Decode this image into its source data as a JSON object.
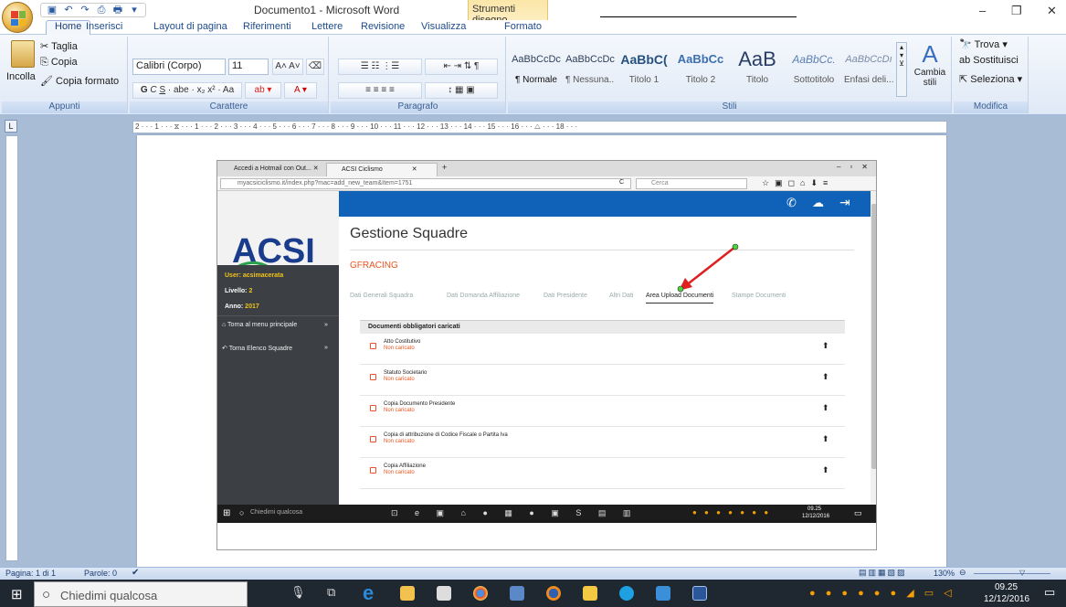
{
  "window": {
    "title": "Documento1 - Microsoft Word",
    "context_tab": "Strumenti disegno",
    "minimize": "–",
    "restore": "❐",
    "close": "✕"
  },
  "tabs": [
    "Home",
    "Inserisci",
    "Layout di pagina",
    "Riferimenti",
    "Lettere",
    "Revisione",
    "Visualizza",
    "Formato"
  ],
  "ribbon": {
    "clipboard": {
      "paste": "Incolla",
      "cut": "Taglia",
      "copy": "Copia",
      "format_painter": "Copia formato",
      "label": "Appunti"
    },
    "font": {
      "name": "Calibri (Corpo)",
      "size": "11",
      "label": "Carattere"
    },
    "paragraph": {
      "label": "Paragrafo"
    },
    "styles": {
      "items": [
        {
          "sample": "AaBbCcDc",
          "name": "¶ Normale"
        },
        {
          "sample": "AaBbCcDc",
          "name": "¶ Nessuna..."
        },
        {
          "sample": "AaBbC(",
          "name": "Titolo 1"
        },
        {
          "sample": "AaBbCc",
          "name": "Titolo 2"
        },
        {
          "sample": "AaB",
          "name": "Titolo"
        },
        {
          "sample": "AaBbCc.",
          "name": "Sottotitolo"
        },
        {
          "sample": "AaBbCcDı",
          "name": "Enfasi deli..."
        }
      ],
      "change": "Cambia stili",
      "label": "Stili"
    },
    "editing": {
      "find": "Trova",
      "replace": "Sostituisci",
      "select": "Seleziona",
      "label": "Modifica"
    }
  },
  "ruler": {
    "marks": "2 · · · 1 · · · ⧖ · · · 1 · · · 2 · · · 3 · · · 4 · · · 5 · · · 6 · · · 7 · · · 8 · · · 9 · · · 10 · · · 11 · · · 12 · · · 13 · · · 14 · · · 15 · · · 16 · · · △ · · · 18 · · ·"
  },
  "browser": {
    "tabs": [
      "Accedi a Hotmail con Out...",
      "ACSI Ciclismo"
    ],
    "url": "myacsiciclismo.it/index.php?mac=add_new_team&Item=1751",
    "search_placeholder": "Cerca"
  },
  "app": {
    "title": "Gestione Squadre",
    "team": "GFRACING",
    "user_label": "User:",
    "user": "acsimacerata",
    "level_label": "Livello:",
    "level": "2",
    "year_label": "Anno:",
    "year": "2017",
    "menu": [
      "Torna al menu principale",
      "Torna Elenco Squadre"
    ],
    "tabs": [
      "Dati Generali Squadra",
      "Dati Domanda Affiliazione",
      "Dati Presidente",
      "Altri Dati",
      "Area Upload Documenti",
      "Stampe Documenti"
    ],
    "active_tab": "Area Upload Documenti",
    "section_title": "Documenti obbligatori caricati",
    "documents": [
      {
        "name": "Atto Costitutivo",
        "status": "Non caricato"
      },
      {
        "name": "Statuto Societario",
        "status": "Non caricato"
      },
      {
        "name": "Copia Documento Presidente",
        "status": "Non caricato"
      },
      {
        "name": "Copia di attribuzione di Codice Fiscale o Partita Iva",
        "status": "Non caricato"
      },
      {
        "name": "Copia Affiliazione",
        "status": "Non caricato"
      }
    ]
  },
  "inner_taskbar": {
    "search": "Chiedimi qualcosa",
    "time": "09.25",
    "date": "12/12/2016"
  },
  "status": {
    "page": "Pagina: 1 di 1",
    "words": "Parole: 0",
    "zoom": "130%"
  },
  "taskbar": {
    "search": "Chiedimi qualcosa",
    "time": "09.25",
    "date": "12/12/2016"
  },
  "colors": {
    "accent": "#0f62b8",
    "orange": "#e8551f",
    "arrow": "#e02020"
  }
}
